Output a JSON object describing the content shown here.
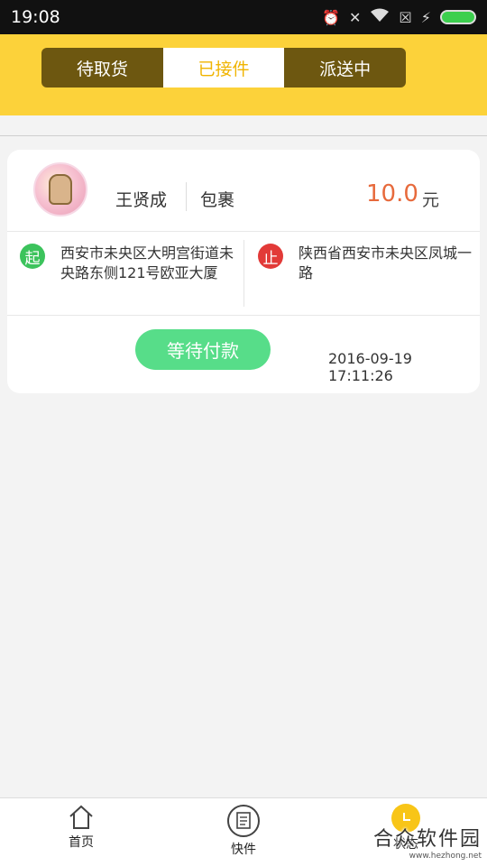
{
  "status_bar": {
    "time": "19:08",
    "icons": [
      "alarm-icon",
      "vibrate-off-icon",
      "wifi-icon",
      "sim-off-icon",
      "charging-icon",
      "battery-icon"
    ]
  },
  "tabs": [
    {
      "label": "待取货",
      "active": false
    },
    {
      "label": "已接件",
      "active": true
    },
    {
      "label": "派送中",
      "active": false
    }
  ],
  "order": {
    "customer_name": "王贤成",
    "item_type": "包裹",
    "price": "10.0",
    "price_unit": "元",
    "start_badge": "起",
    "start_address": "西安市未央区大明宫街道未央路东侧121号欧亚大厦",
    "end_badge": "止",
    "end_address": "陕西省西安市未央区凤城一路",
    "status_label": "等待付款",
    "timestamp": "2016-09-19 17:11:26"
  },
  "bottom_nav": [
    {
      "label": "首页",
      "icon": "home-icon"
    },
    {
      "label": "快件",
      "icon": "express-icon"
    },
    {
      "label": "状态",
      "icon": "clock-icon"
    }
  ],
  "watermark": {
    "text": "合众软件园",
    "url": "www.hezhong.net"
  },
  "colors": {
    "header": "#fcd23a",
    "segment_dark": "#6d5710",
    "price": "#e76a3c",
    "status_button": "#57dd89",
    "start_badge": "#3cc35c",
    "end_badge": "#e23a38"
  }
}
